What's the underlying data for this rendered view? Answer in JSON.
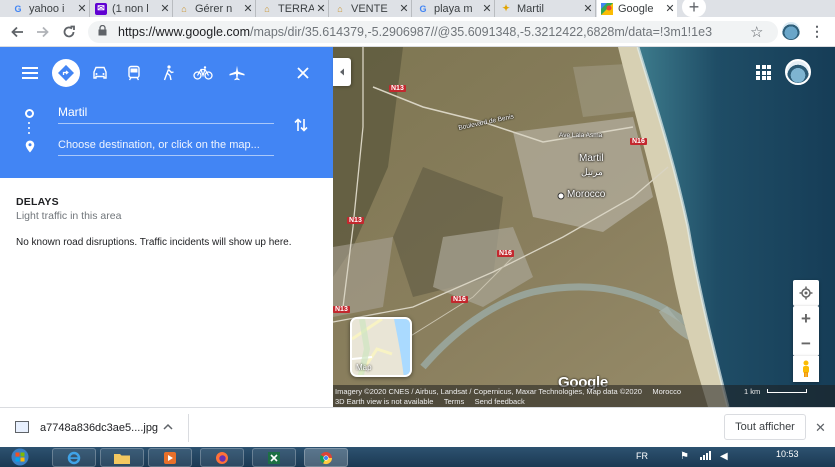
{
  "browser": {
    "tabs": [
      {
        "title": "yahoo i",
        "icon": "google-icon"
      },
      {
        "title": "(1 non l",
        "icon": "yahoo-mail-icon"
      },
      {
        "title": "Gérer n",
        "icon": "website-icon"
      },
      {
        "title": "TERRAI",
        "icon": "website-icon"
      },
      {
        "title": "VENTE",
        "icon": "website-icon"
      },
      {
        "title": "playa m",
        "icon": "google-icon"
      },
      {
        "title": "Martil",
        "icon": "website-icon"
      },
      {
        "title": "Google",
        "icon": "google-maps-icon"
      }
    ],
    "url_host": "https://www.google.com",
    "url_path": "/maps/dir/35.614379,-5.2906987//@35.6091348,-5.3212422,6828m/data=!3m1!1e3"
  },
  "directions": {
    "origin": "Martil",
    "destination_placeholder": "Choose destination, or click on the map..."
  },
  "traffic": {
    "heading": "DELAYS",
    "subtitle": "Light traffic in this area",
    "message": "No known road disruptions. Traffic incidents will show up here."
  },
  "map": {
    "labels": {
      "martil": "Martil",
      "martil_ar": "مرتيل",
      "morocco": "Morocco",
      "road_1": "N13",
      "road_2": "N13",
      "road_3": "N13",
      "road_4": "N16",
      "road_5": "N16",
      "road_6": "N16",
      "street": "Boulevard de Benis",
      "street_2": "Ave Lala Asma"
    },
    "minimap_label": "Map",
    "logo": "Google",
    "attribution": "Imagery ©2020 CNES / Airbus, Landsat / Copernicus, Maxar Technologies, Map data ©2020",
    "region": "Morocco",
    "scale": "1 km",
    "earth_view": "3D Earth view is not available",
    "terms": "Terms",
    "feedback": "Send feedback"
  },
  "download": {
    "filename": "a7748a836dc3ae5....jpg",
    "show_all": "Tout afficher"
  },
  "taskbar": {
    "lang": "FR",
    "time": "10:53"
  }
}
